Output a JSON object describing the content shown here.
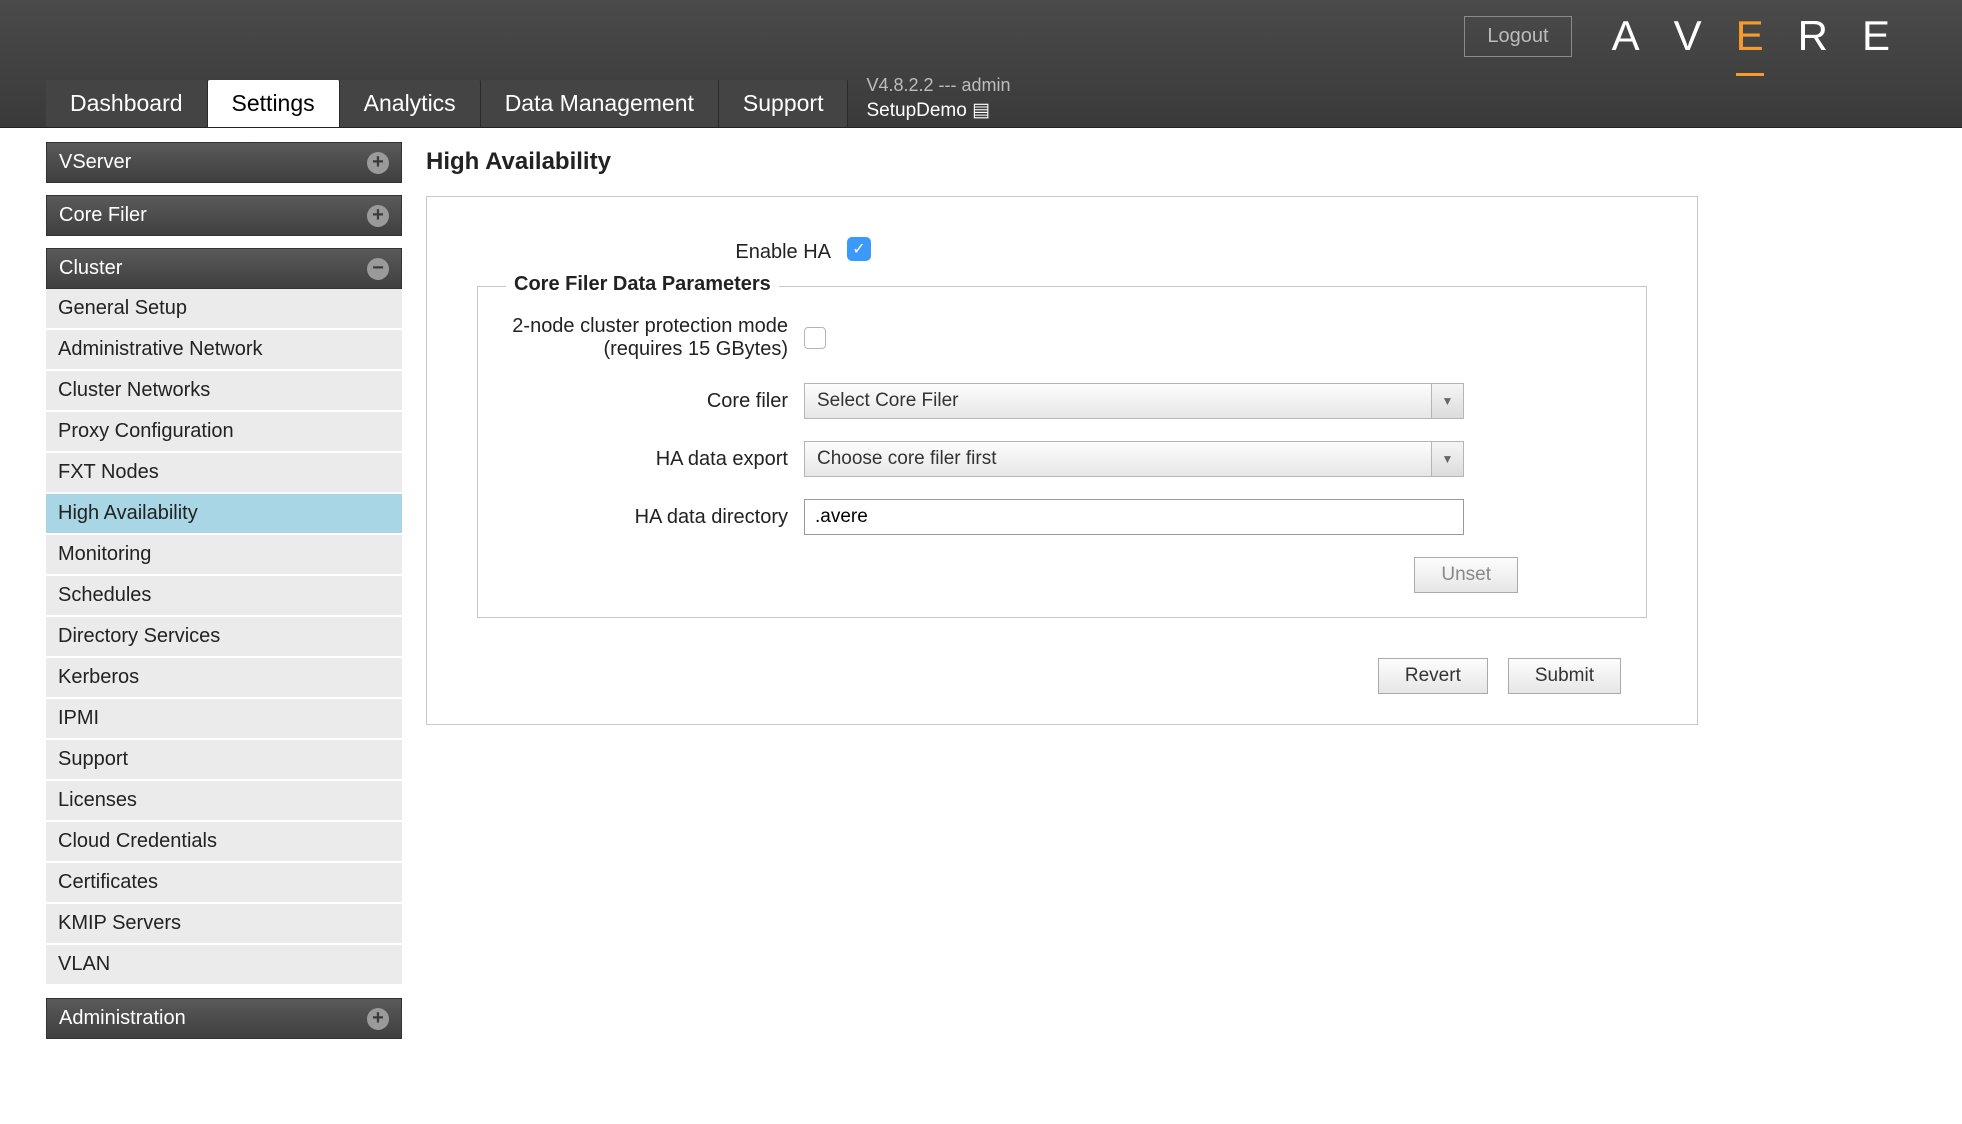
{
  "header": {
    "logout": "Logout",
    "logo_letters": [
      "A",
      "V",
      "E",
      "R",
      "E"
    ],
    "tabs": [
      "Dashboard",
      "Settings",
      "Analytics",
      "Data Management",
      "Support"
    ],
    "active_tab": "Settings",
    "version_line": "V4.8.2.2 --- admin",
    "cluster_name": "SetupDemo"
  },
  "sidebar": {
    "groups": [
      {
        "title": "VServer",
        "expanded": false,
        "items": []
      },
      {
        "title": "Core Filer",
        "expanded": false,
        "items": []
      },
      {
        "title": "Cluster",
        "expanded": true,
        "items": [
          "General Setup",
          "Administrative Network",
          "Cluster Networks",
          "Proxy Configuration",
          "FXT Nodes",
          "High Availability",
          "Monitoring",
          "Schedules",
          "Directory Services",
          "Kerberos",
          "IPMI",
          "Support",
          "Licenses",
          "Cloud Credentials",
          "Certificates",
          "KMIP Servers",
          "VLAN"
        ],
        "active_item": "High Availability"
      },
      {
        "title": "Administration",
        "expanded": false,
        "items": []
      }
    ]
  },
  "page": {
    "title": "High Availability",
    "enable_label": "Enable HA",
    "enable_checked": true,
    "fieldset_legend": "Core Filer Data Parameters",
    "two_node_label": "2-node cluster protection mode (requires 15 GBytes)",
    "two_node_checked": false,
    "core_filer_label": "Core filer",
    "core_filer_value": "Select Core Filer",
    "ha_export_label": "HA data export",
    "ha_export_value": "Choose core filer first",
    "ha_dir_label": "HA data directory",
    "ha_dir_value": ".avere",
    "unset_btn": "Unset",
    "revert_btn": "Revert",
    "submit_btn": "Submit"
  }
}
